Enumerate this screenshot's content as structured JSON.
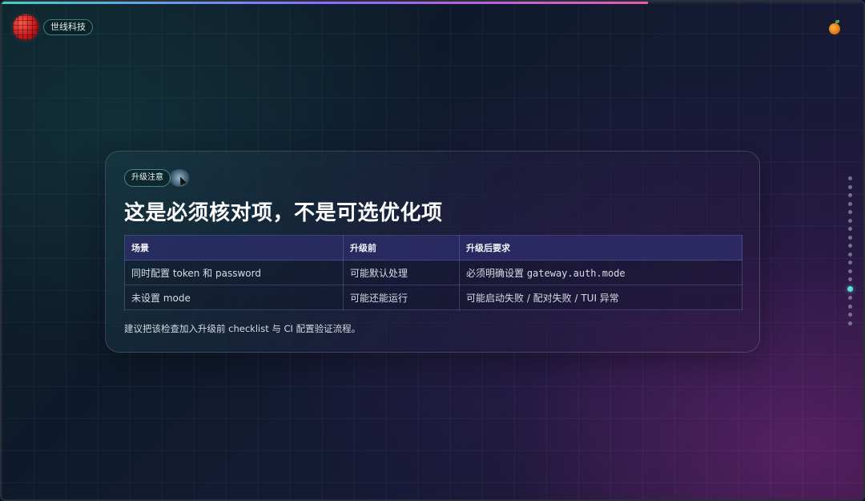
{
  "header": {
    "brand_badge": "世线科技",
    "logo_icon": "globe-logo-icon",
    "top_right_icon": "orange-fruit-icon",
    "progress": 0.75
  },
  "card": {
    "tag": "升级注意",
    "title": "这是必须核对项，不是可选优化项",
    "table": {
      "headers": [
        "场景",
        "升级前",
        "升级后要求"
      ],
      "rows": [
        [
          "同时配置 token 和 password",
          "可能默认处理",
          "必须明确设置 ",
          "gateway.auth.mode"
        ],
        [
          "未设置 mode",
          "可能还能运行",
          "可能启动失败 / 配对失败 / TUI 异常",
          ""
        ]
      ]
    },
    "note": "建议把该检查加入升级前 checklist 与 CI 配置验证流程。"
  },
  "nav": {
    "total_slides": 18,
    "active_index": 13,
    "active_color": "#5fe0d2"
  }
}
